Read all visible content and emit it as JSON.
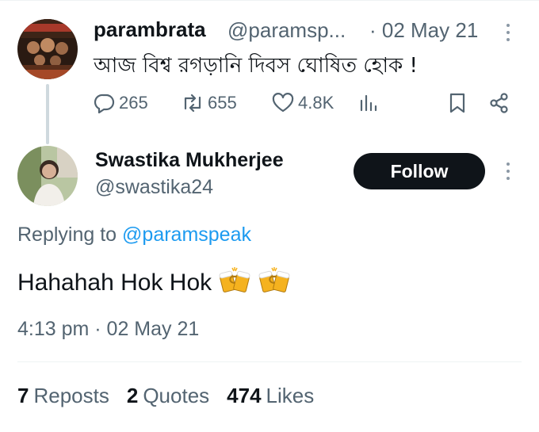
{
  "parent_tweet": {
    "author_name": "parambrata",
    "author_handle": "@paramsp...",
    "date": "· 02 May 21",
    "text": "আজ বিশ্ব রগড়ানি দিবস ঘোষিত হোক !",
    "actions": {
      "replies": "265",
      "reposts": "655",
      "likes": "4.8K"
    }
  },
  "reply": {
    "author_name": "Swastika Mukherjee",
    "author_handle": "@swastika24",
    "follow_label": "Follow",
    "replying_prefix": "Replying to",
    "replying_handle": "@paramspeak",
    "text": "Hahahah Hok Hok",
    "emojis": [
      "beer-mugs-icon",
      "beer-mugs-icon"
    ],
    "timestamp": "4:13 pm · 02 May 21",
    "stats": {
      "reposts_count": "7",
      "reposts_label": "Reposts",
      "quotes_count": "2",
      "quotes_label": "Quotes",
      "likes_count": "474",
      "likes_label": "Likes"
    }
  },
  "colors": {
    "text_primary": "#0f1419",
    "text_secondary": "#536471",
    "link": "#1d9bf0",
    "follow_bg": "#0f1419",
    "thread_line": "#cfd9de"
  }
}
